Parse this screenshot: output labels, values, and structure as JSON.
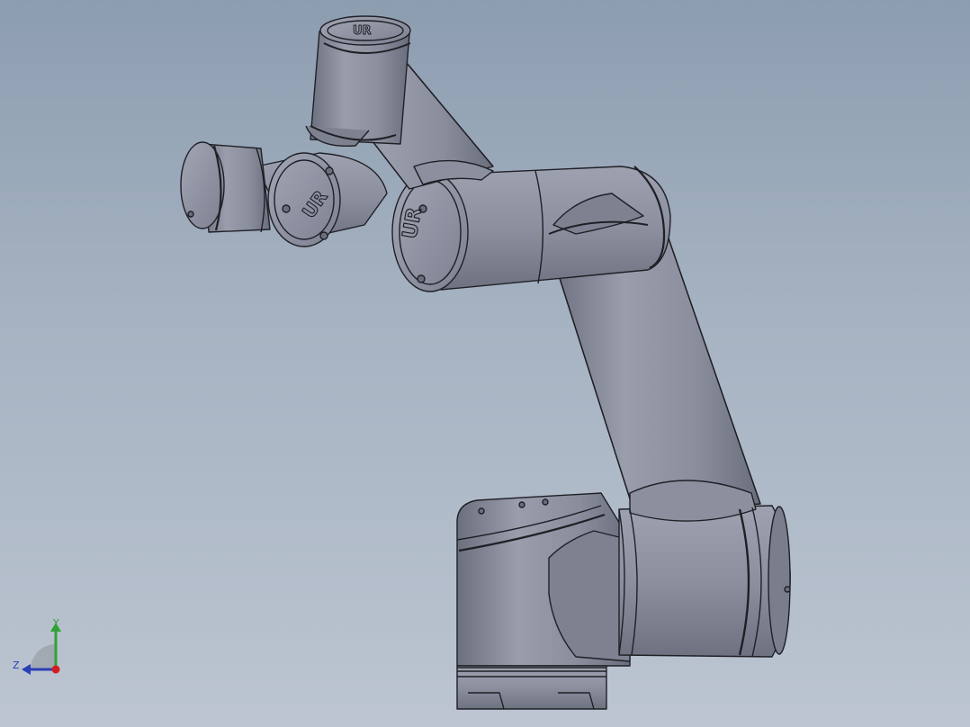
{
  "viewport": {
    "background_top": "#8d9db0",
    "background_bottom": "#bcc5d1",
    "part_color": "#8a8e9c",
    "edge_color": "#1f2026"
  },
  "model": {
    "logo_text": "UR"
  },
  "triad": {
    "y_label": "Y",
    "z_label": "Z",
    "y_color": "#2fa336",
    "z_color": "#2a3fb5",
    "x_color": "#d11f1f"
  }
}
